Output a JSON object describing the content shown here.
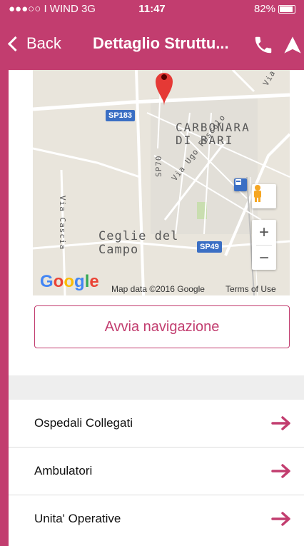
{
  "status_bar": {
    "carrier": "●●●○○ I WIND  3G",
    "time": "11:47",
    "battery": "82%",
    "battery_level": 0.82
  },
  "navbar": {
    "back_label": "Back",
    "title": "Dettaglio Struttu...",
    "icons": [
      "phone-icon",
      "navigation-icon"
    ]
  },
  "map": {
    "labels": {
      "carbonara": "CARBONARA\nDI BARI",
      "ceglie": "Ceglie del\nCampo",
      "via_ugo": "Via Ugo Foscolo",
      "via_cascia": "Via Cascia",
      "sp70": "SP70",
      "via_r": "Via R"
    },
    "badges": {
      "sp183": "SP183",
      "sp49": "SP49"
    },
    "google": "Google",
    "attribution": "Map data ©2016 Google",
    "terms": "Terms of Use",
    "zoom_in": "+",
    "zoom_out": "−"
  },
  "primary_button": "Avvia navigazione",
  "menu": {
    "items": [
      "Ospedali Collegati",
      "Ambulatori",
      "Unita' Operative"
    ]
  },
  "colors": {
    "brand": "#c23d6f",
    "background": "#eeeeee"
  }
}
